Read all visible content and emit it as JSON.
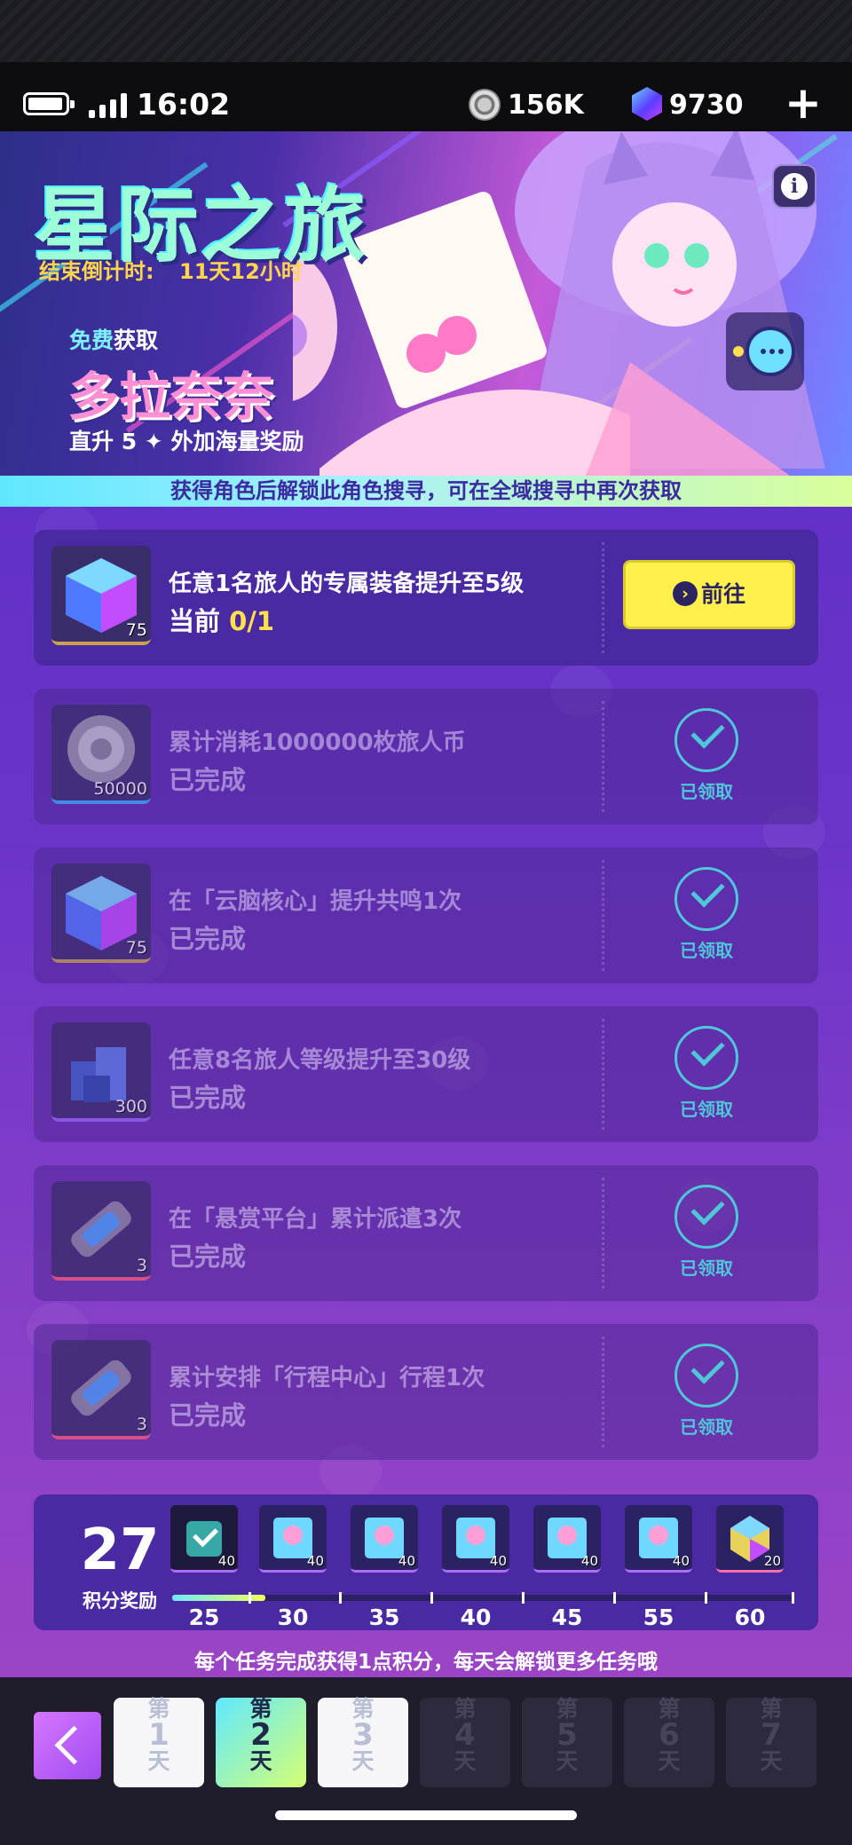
{
  "status_bar": {
    "time": "16:02",
    "coins": "156K",
    "gems": "9730",
    "plus_label": "+"
  },
  "banner": {
    "title": "星际之旅",
    "countdown_label": "结束倒计时:",
    "countdown_value": "11天12小时",
    "free_a": "免费",
    "free_b": "获取",
    "character_name": "多拉奈奈",
    "subtitle": "直升 5 ✦ 外加海量奖励",
    "info_label": "i"
  },
  "notice": "获得角色后解锁此角色搜寻，可在全域搜寻中再次获取",
  "tasks": [
    {
      "title": "任意1名旅人的专属装备提升至5级",
      "status_prefix": "当前 ",
      "progress": "0/1",
      "qty": "75",
      "action": "前往",
      "arrow": "›"
    },
    {
      "title": "累计消耗1000000枚旅人币",
      "status": "已完成",
      "qty": "50000",
      "claimed": "已领取"
    },
    {
      "title": "在「云脑核心」提升共鸣1次",
      "status": "已完成",
      "qty": "75",
      "claimed": "已领取"
    },
    {
      "title": "任意8名旅人等级提升至30级",
      "status": "已完成",
      "qty": "300",
      "claimed": "已领取"
    },
    {
      "title": "在「悬赏平台」累计派遣3次",
      "status": "已完成",
      "qty": "3",
      "claimed": "已领取"
    },
    {
      "title": "累计安排「行程中心」行程1次",
      "status": "已完成",
      "qty": "3",
      "claimed": "已领取"
    }
  ],
  "points": {
    "value": "27",
    "label": "积分奖励",
    "progress_fraction": 0.15,
    "milestones": [
      "25",
      "30",
      "35",
      "40",
      "45",
      "55",
      "60"
    ],
    "reward_qty": [
      "40",
      "40",
      "40",
      "40",
      "40",
      "40",
      "20"
    ]
  },
  "footer_tip": "每个任务完成获得1点积分，每天会解锁更多任务哦",
  "days": [
    {
      "a": "第",
      "n": "1",
      "b": "天"
    },
    {
      "a": "第",
      "n": "2",
      "b": "天"
    },
    {
      "a": "第",
      "n": "3",
      "b": "天"
    },
    {
      "a": "第",
      "n": "4",
      "b": "天"
    },
    {
      "a": "第",
      "n": "5",
      "b": "天"
    },
    {
      "a": "第",
      "n": "6",
      "b": "天"
    },
    {
      "a": "第",
      "n": "7",
      "b": "天"
    }
  ],
  "colors": {
    "accent_yellow": "#fff04d",
    "claimed_teal": "#4ec7d9",
    "progress_yellow": "#ffe24a"
  }
}
